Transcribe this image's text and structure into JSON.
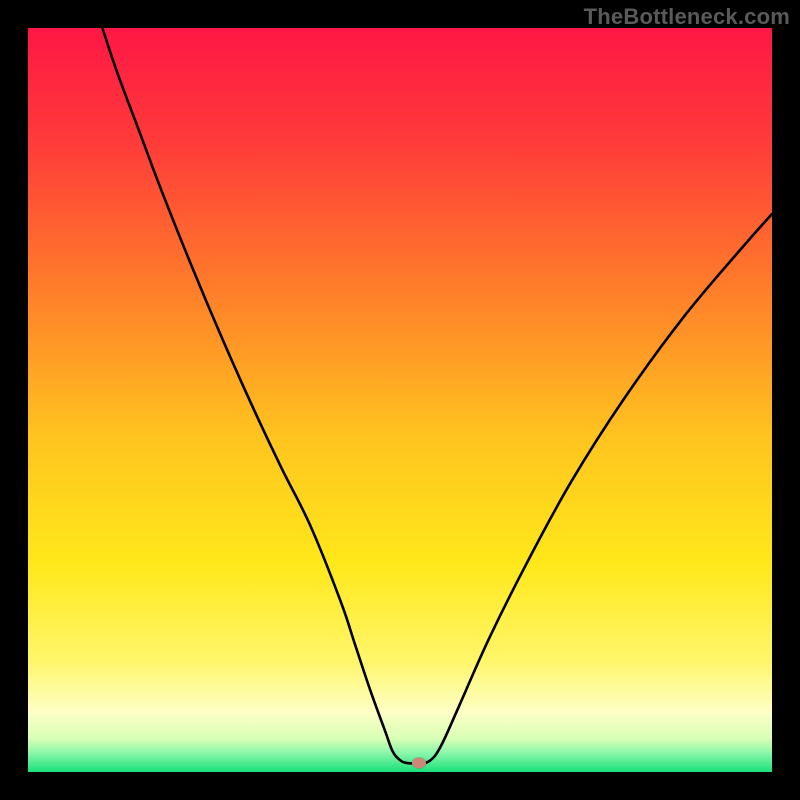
{
  "watermark": "TheBottleneck.com",
  "chart_data": {
    "type": "line",
    "title": "",
    "xlabel": "",
    "ylabel": "",
    "xlim": [
      0,
      100
    ],
    "ylim": [
      0,
      100
    ],
    "grid": false,
    "legend": false,
    "gradient_background": {
      "stops": [
        {
          "pos": 0.0,
          "color": "#ff1745"
        },
        {
          "pos": 0.15,
          "color": "#ff3a3a"
        },
        {
          "pos": 0.35,
          "color": "#ff7d2a"
        },
        {
          "pos": 0.55,
          "color": "#ffc41f"
        },
        {
          "pos": 0.72,
          "color": "#ffe81a"
        },
        {
          "pos": 0.85,
          "color": "#fff66a"
        },
        {
          "pos": 0.92,
          "color": "#fdffc5"
        },
        {
          "pos": 0.955,
          "color": "#d9ffb6"
        },
        {
          "pos": 0.975,
          "color": "#88f6a8"
        },
        {
          "pos": 1.0,
          "color": "#18e07a"
        }
      ]
    },
    "series": [
      {
        "name": "bottleneck-curve",
        "color": "#000000",
        "width": 2.6,
        "x": [
          10,
          12,
          15,
          18,
          22,
          26,
          30,
          34,
          38,
          42,
          44,
          46,
          48,
          49,
          50,
          51,
          52.5,
          54,
          55.5,
          58,
          62,
          67,
          73,
          80,
          88,
          96,
          100
        ],
        "y": [
          100,
          94,
          86,
          78,
          68,
          58.5,
          49.5,
          41,
          33,
          23,
          17,
          11,
          5.5,
          2.8,
          1.6,
          1.2,
          1.2,
          1.5,
          3.5,
          9,
          18,
          28,
          39,
          50,
          61,
          70.5,
          75
        ]
      }
    ],
    "badges": [
      {
        "name": "optimal-marker",
        "x": 52.5,
        "y": 1.2,
        "color": "#cc8877"
      }
    ]
  }
}
